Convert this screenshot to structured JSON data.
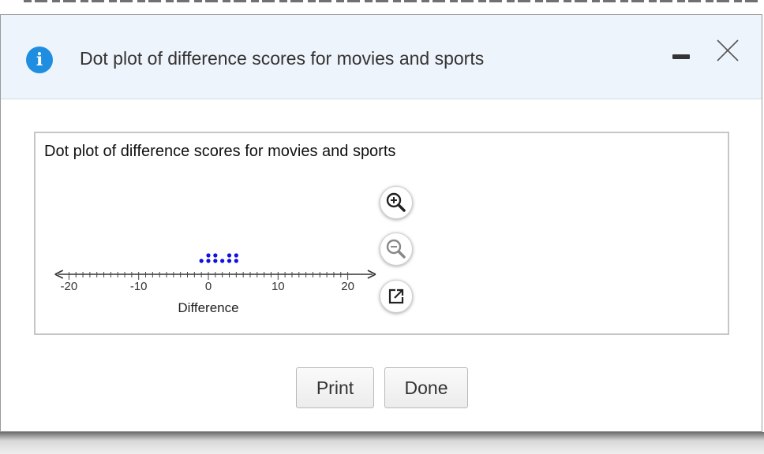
{
  "dialog": {
    "title": "Dot plot of difference scores for movies and sports",
    "info_icon": "i"
  },
  "panel": {
    "title": "Dot plot of difference scores for movies and sports"
  },
  "chart_data": {
    "type": "dotplot",
    "xlabel": "Difference",
    "xlim": [
      -22,
      24
    ],
    "ticks": [
      -20,
      -10,
      0,
      10,
      20
    ],
    "tick_labels": [
      "-20",
      "-10",
      "0",
      "10",
      "20"
    ],
    "minor_tick_step": 1,
    "dot_color": "#1010e0",
    "points": [
      {
        "x": -1,
        "count": 1
      },
      {
        "x": 0,
        "count": 2
      },
      {
        "x": 1,
        "count": 2
      },
      {
        "x": 2,
        "count": 1
      },
      {
        "x": 3,
        "count": 2
      },
      {
        "x": 4,
        "count": 2
      }
    ]
  },
  "tools": {
    "zoom_in": "zoom-in-icon",
    "zoom_out": "zoom-out-icon",
    "open": "external-link-icon"
  },
  "buttons": {
    "print": "Print",
    "done": "Done"
  }
}
